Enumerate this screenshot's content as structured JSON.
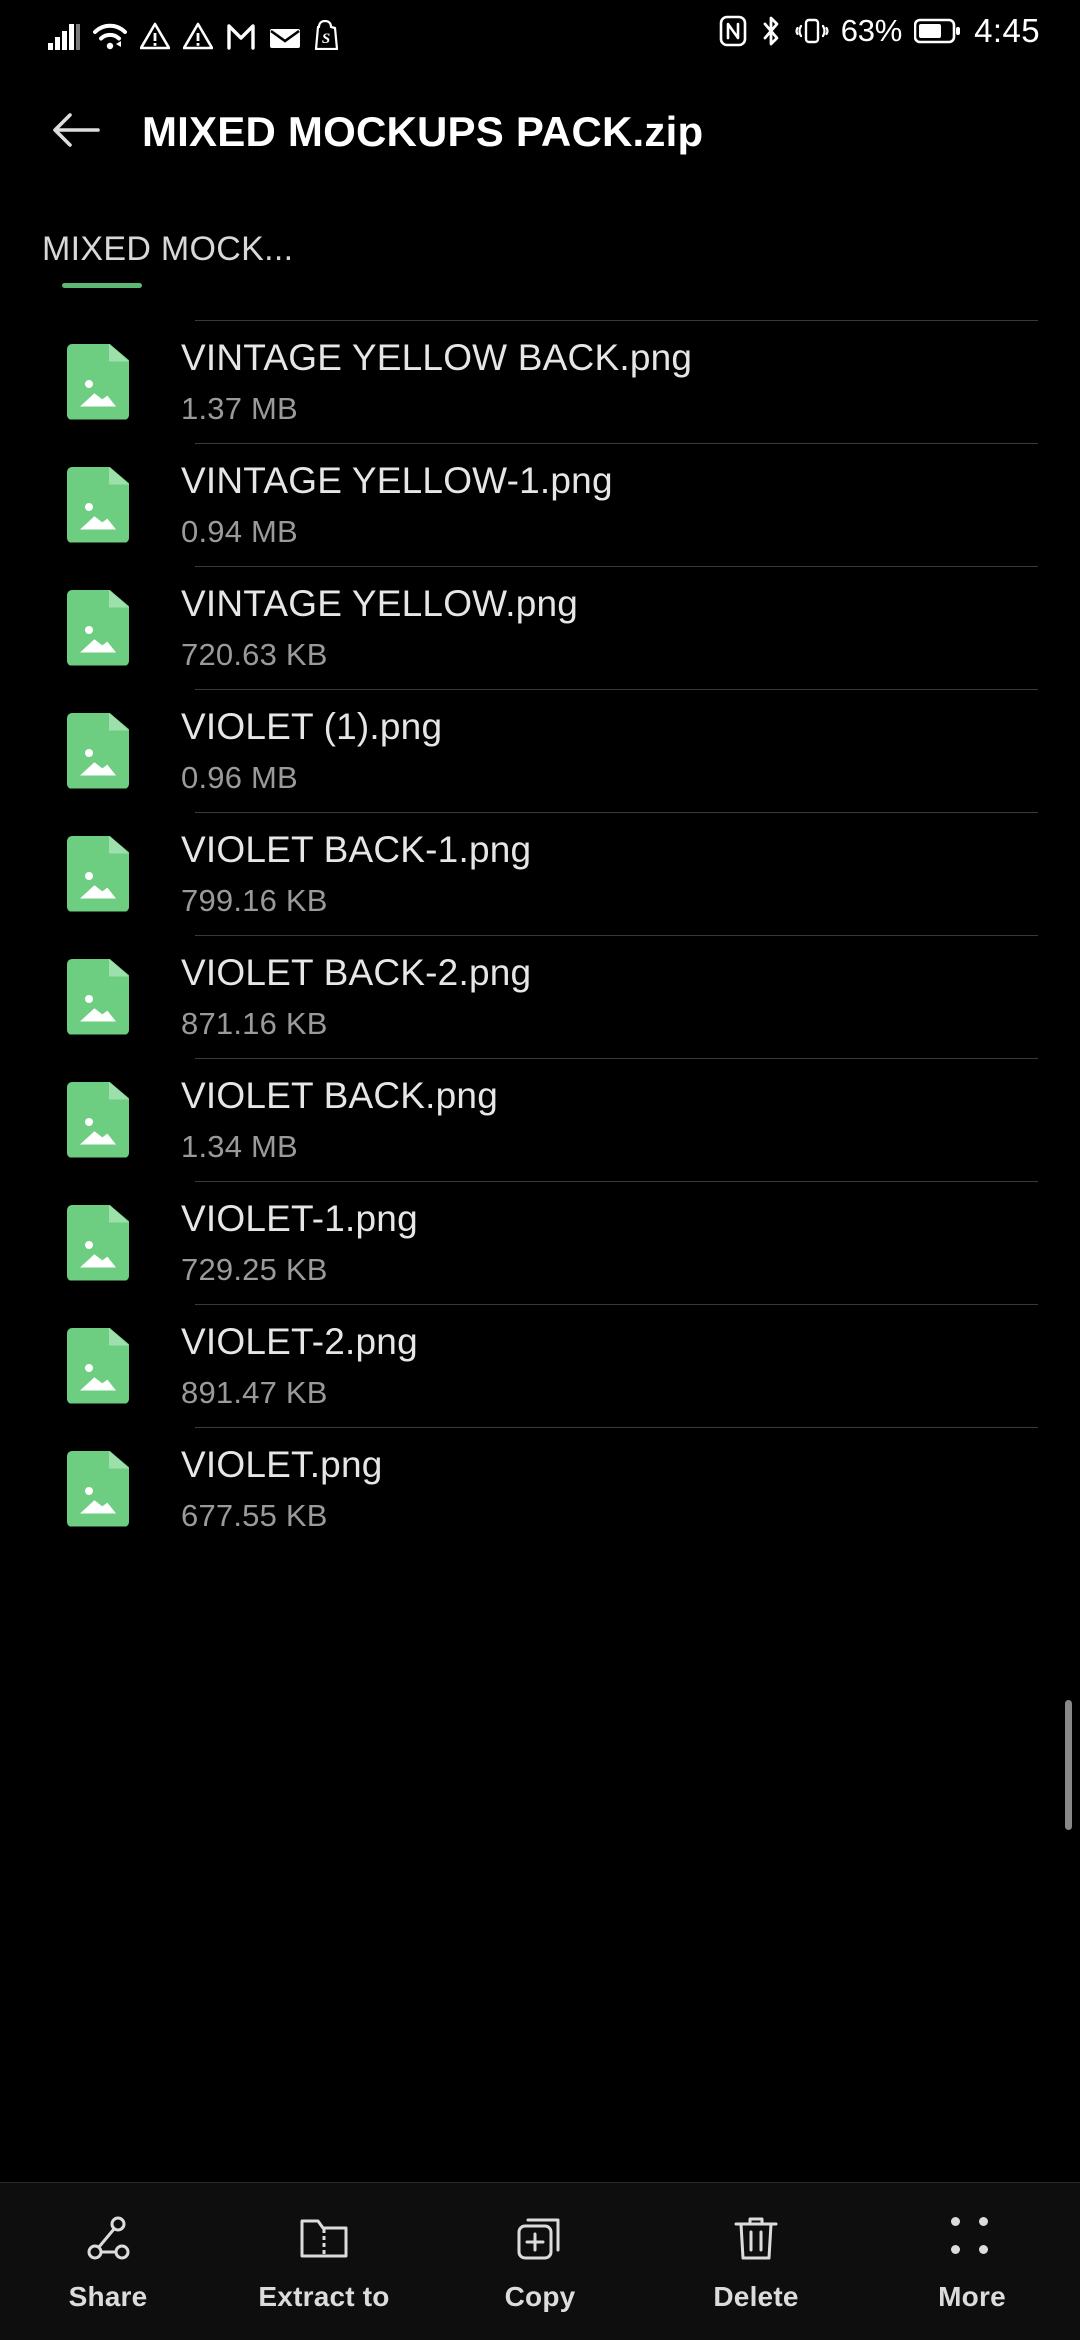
{
  "status_bar": {
    "left_icons": [
      "signal-bars-icon",
      "wifi-icon",
      "warning-triangle-icon",
      "warning-triangle-icon",
      "gmail-icon",
      "mail-envelope-icon",
      "shopify-icon"
    ],
    "right_icons": [
      "nfc-icon",
      "bluetooth-icon",
      "vibrate-icon",
      "battery-icon"
    ],
    "battery_percent": "63%",
    "clock": "4:45"
  },
  "app_bar": {
    "back_icon": "arrow-left-icon",
    "title": "MIXED MOCKUPS PACK.zip"
  },
  "breadcrumb": {
    "items": [
      {
        "label": "MIXED MOCK...",
        "active": true
      }
    ],
    "accent_color": "#5bb974"
  },
  "file_list": {
    "icon_color": "#6dce82",
    "files": [
      {
        "name": "VINTAGE YELLOW BACK.png",
        "size": "1.37 MB",
        "icon": "image-file-icon"
      },
      {
        "name": "VINTAGE YELLOW-1.png",
        "size": "0.94 MB",
        "icon": "image-file-icon"
      },
      {
        "name": "VINTAGE YELLOW.png",
        "size": "720.63 KB",
        "icon": "image-file-icon"
      },
      {
        "name": "VIOLET (1).png",
        "size": "0.96 MB",
        "icon": "image-file-icon"
      },
      {
        "name": "VIOLET BACK-1.png",
        "size": "799.16 KB",
        "icon": "image-file-icon"
      },
      {
        "name": "VIOLET BACK-2.png",
        "size": "871.16 KB",
        "icon": "image-file-icon"
      },
      {
        "name": "VIOLET BACK.png",
        "size": "1.34 MB",
        "icon": "image-file-icon"
      },
      {
        "name": "VIOLET-1.png",
        "size": "729.25 KB",
        "icon": "image-file-icon"
      },
      {
        "name": "VIOLET-2.png",
        "size": "891.47 KB",
        "icon": "image-file-icon"
      },
      {
        "name": "VIOLET.png",
        "size": "677.55 KB",
        "icon": "image-file-icon"
      }
    ]
  },
  "toolbar": {
    "items": [
      {
        "label": "Share",
        "icon": "share-nodes-icon"
      },
      {
        "label": "Extract to",
        "icon": "folder-zip-icon"
      },
      {
        "label": "Copy",
        "icon": "copy-plus-icon"
      },
      {
        "label": "Delete",
        "icon": "trash-icon"
      },
      {
        "label": "More",
        "icon": "four-dots-icon"
      }
    ]
  }
}
